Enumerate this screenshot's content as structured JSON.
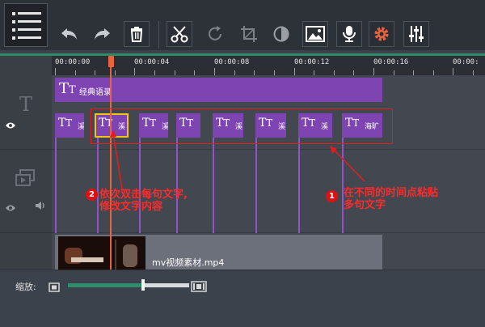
{
  "top_tabs": [
    "",
    "",
    ""
  ],
  "toolbar": {
    "buttons": [
      "undo-icon",
      "redo-icon",
      "trash-icon",
      "scissors-icon",
      "rotate-icon",
      "crop-icon",
      "color-icon",
      "image-icon",
      "microphone-icon",
      "settings-icon",
      "equalizer-icon"
    ],
    "accent": "#e9633e"
  },
  "timeline": {
    "ruler_labels": [
      "00:00:00",
      "00:00:04",
      "00:00:08",
      "00:00:12",
      "00:00:16",
      "00:00:"
    ],
    "title_track_label": "经典语录",
    "title_clips": [
      "溪",
      "溪",
      "溪",
      "",
      "溪",
      "溪",
      "溪",
      "海旷"
    ],
    "video_clip_name": "mv视频素材.mp4",
    "clip_color": "#7e45b2"
  },
  "annotations": {
    "note1_number": "1",
    "note1_line1": "在不同的时间点粘贴",
    "note1_line2": "多句文字",
    "note2_number": "2",
    "note2_line1": "依次双击每句文字,",
    "note2_line2": "修改文字内容"
  },
  "zoom": {
    "label": "缩放:",
    "level": 0.62
  }
}
